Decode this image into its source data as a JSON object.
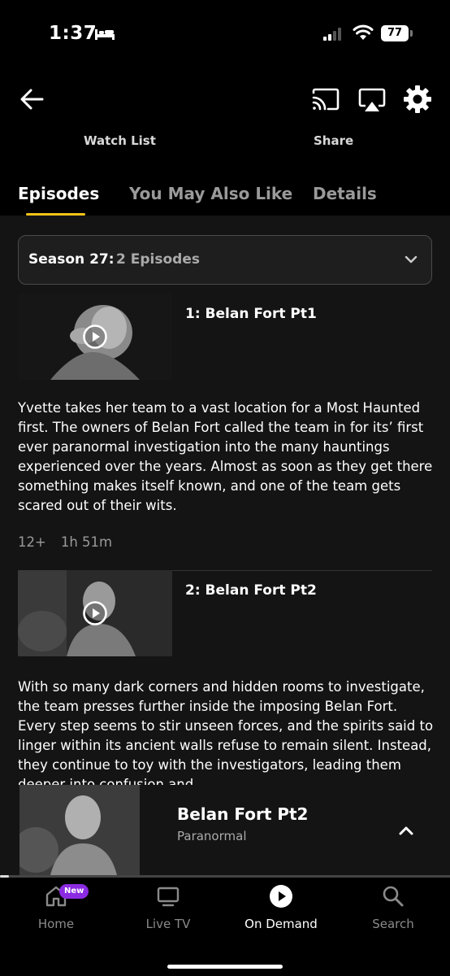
{
  "status_bar": {
    "time": "1:37",
    "battery": "77"
  },
  "top_nav": {
    "watch_list_label": "Watch List",
    "share_label": "Share"
  },
  "tabs": [
    {
      "label": "Episodes"
    },
    {
      "label": "You May Also Like"
    },
    {
      "label": "Details"
    }
  ],
  "season": {
    "label": "Season 27:",
    "count": "2 Episodes"
  },
  "episodes": [
    {
      "title": "1: Belan Fort Pt1",
      "description": "Yvette takes her team to a vast location for a Most Haunted first. The owners of Belan Fort called the team in for its’ first ever paranormal investigation into the many hauntings experienced over the years. Almost as soon as they get there something makes itself known, and one of the team gets scared out of their wits.",
      "rating": "12+",
      "duration": "1h 51m"
    },
    {
      "title": "2: Belan Fort Pt2",
      "description": "With so many dark corners and hidden rooms to investigate, the team presses further inside the imposing Belan Fort. Every step seems to stir unseen forces, and the spirits said to linger within its ancient walls refuse to remain silent. Instead, they continue to toy with the investigators, leading them deeper into confusion and"
    }
  ],
  "mini_player": {
    "title": "Belan Fort Pt2",
    "subtitle": "Paranormal",
    "progress": 0.02
  },
  "bottom_nav": [
    {
      "label": "Home",
      "badge": "New",
      "icon": "home-icon"
    },
    {
      "label": "Live TV",
      "icon": "tv-icon"
    },
    {
      "label": "On Demand",
      "icon": "play-circle-icon"
    },
    {
      "label": "Search",
      "icon": "search-icon"
    }
  ],
  "colors": {
    "accent": "#f5c518",
    "badge": "#8b2be2",
    "background": "#000000",
    "panel": "#141414"
  }
}
